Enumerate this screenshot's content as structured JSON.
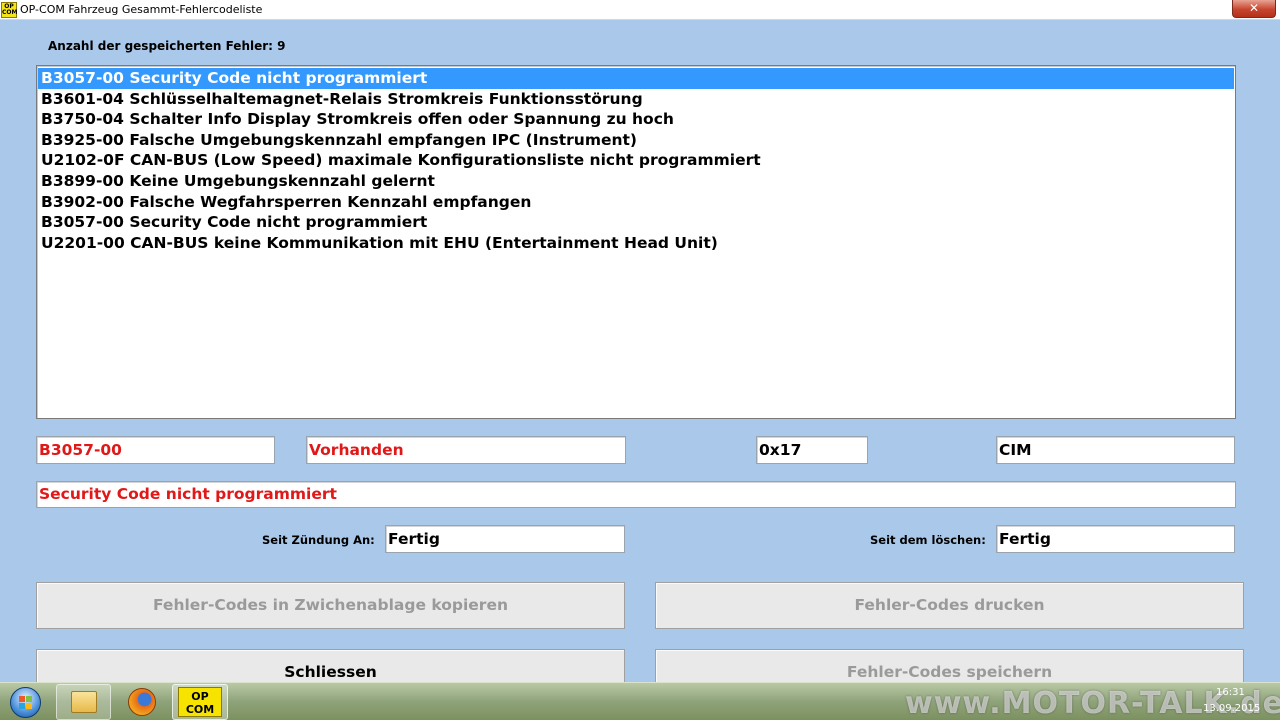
{
  "window": {
    "title": "OP-COM Fahrzeug Gesammt-Fehlercodeliste",
    "icon_text": [
      "OP",
      "COM"
    ],
    "close_label": "✕"
  },
  "error_count_label": "Anzahl der gespeicherten Fehler: 9",
  "errors": [
    "B3057-00 Security Code nicht programmiert",
    "B3601-04 Schlüsselhaltemagnet-Relais Stromkreis Funktionsstörung",
    "B3750-04 Schalter Info Display Stromkreis offen oder Spannung zu hoch",
    "B3925-00 Falsche Umgebungskennzahl empfangen IPC (Instrument)",
    "U2102-0F CAN-BUS (Low Speed) maximale Konfigurationsliste nicht programmiert",
    "B3899-00 Keine Umgebungskennzahl gelernt",
    "B3902-00 Falsche Wegfahrsperren Kennzahl empfangen",
    "B3057-00 Security Code nicht programmiert",
    "U2201-00 CAN-BUS keine Kommunikation mit EHU (Entertainment Head Unit)"
  ],
  "selected_index": 0,
  "details": {
    "code": "B3057-00",
    "status": "Vorhanden",
    "hex": "0x17",
    "module": "CIM",
    "description": "Security Code nicht programmiert",
    "since_ignition_label": "Seit Zündung An:",
    "since_ignition_value": "Fertig",
    "since_clear_label": "Seit dem löschen:",
    "since_clear_value": "Fertig"
  },
  "buttons": {
    "copy": "Fehler-Codes in Zwichenablage kopieren",
    "print": "Fehler-Codes drucken",
    "close": "Schliessen",
    "save": "Fehler-Codes speichern"
  },
  "taskbar": {
    "opcom_icon_text": [
      "OP",
      "COM"
    ],
    "watermark": "www.MOTOR-TALK.de",
    "clock_time": "16:31",
    "clock_date": "13.09.2015"
  },
  "colors": {
    "window_background": "#a9c8ea",
    "selection": "#3399ff",
    "error_text": "#e01818",
    "disabled_text": "#9a9a9a"
  }
}
